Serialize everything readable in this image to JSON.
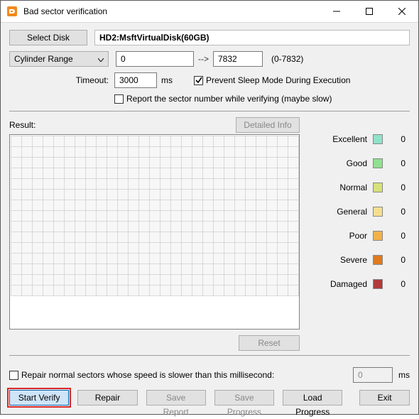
{
  "window": {
    "title": "Bad sector verification"
  },
  "toolbar": {
    "select_disk_label": "Select Disk",
    "disk_value": "HD2:MsftVirtualDisk(60GB)"
  },
  "range": {
    "mode_label": "Cylinder Range",
    "start": "0",
    "end": "7832",
    "hint": "(0-7832)"
  },
  "timeout": {
    "label": "Timeout:",
    "value": "3000",
    "unit": "ms"
  },
  "options": {
    "prevent_sleep_label": "Prevent Sleep Mode During Execution",
    "prevent_sleep_checked": true,
    "report_sector_label": "Report the sector number while verifying (maybe slow)",
    "report_sector_checked": false
  },
  "result": {
    "label": "Result:",
    "detailed_info_label": "Detailed Info",
    "reset_label": "Reset"
  },
  "legend": [
    {
      "label": "Excellent",
      "count": "0",
      "color": "#8fe3c8"
    },
    {
      "label": "Good",
      "count": "0",
      "color": "#8fe08f"
    },
    {
      "label": "Normal",
      "count": "0",
      "color": "#d7e27a"
    },
    {
      "label": "General",
      "count": "0",
      "color": "#f5df8f"
    },
    {
      "label": "Poor",
      "count": "0",
      "color": "#f2b24b"
    },
    {
      "label": "Severe",
      "count": "0",
      "color": "#e07a1e"
    },
    {
      "label": "Damaged",
      "count": "0",
      "color": "#b23a3a"
    }
  ],
  "repair_slow": {
    "label": "Repair normal sectors whose speed is slower than this millisecond:",
    "checked": false,
    "value": "0",
    "unit": "ms"
  },
  "buttons": {
    "start_verify": "Start Verify",
    "repair": "Repair",
    "save_report": "Save Report",
    "save_progress": "Save Progress",
    "load_progress": "Load Progress",
    "exit": "Exit"
  },
  "grid": {
    "rows": 15,
    "cols": 27
  }
}
